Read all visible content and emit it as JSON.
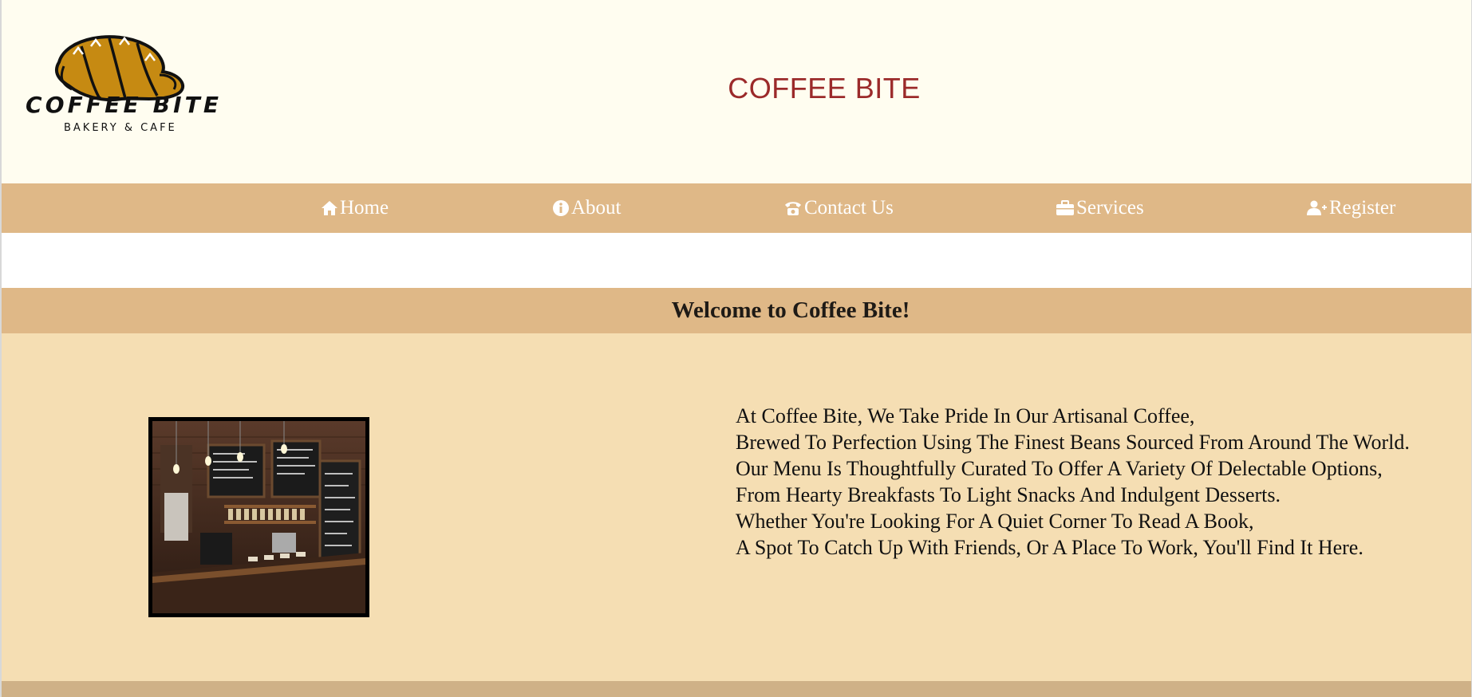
{
  "header": {
    "logo": {
      "title": "COFFEE BITE",
      "subtitle": "BAKERY & CAFE",
      "icon": "croissant-icon"
    },
    "site_title": "COFFEE BITE"
  },
  "nav": {
    "items": [
      {
        "label": "Home",
        "icon": "home-icon"
      },
      {
        "label": "About",
        "icon": "info-icon"
      },
      {
        "label": "Contact Us",
        "icon": "phone-icon"
      },
      {
        "label": "Services",
        "icon": "briefcase-icon"
      },
      {
        "label": "Register",
        "icon": "user-plus-icon"
      }
    ]
  },
  "welcome": {
    "heading": "Welcome to Coffee Bite!"
  },
  "main": {
    "image": {
      "name": "cafe-interior-photo"
    },
    "paragraph": [
      "At Coffee Bite, We Take Pride In Our Artisanal Coffee,",
      "Brewed To Perfection Using The Finest Beans Sourced From Around The World.",
      "Our Menu Is Thoughtfully Curated To Offer A Variety Of Delectable Options,",
      "From Hearty Breakfasts To Light Snacks And Indulgent Desserts.",
      "Whether You're Looking For A Quiet Corner To Read A Book,",
      "A Spot To Catch Up With Friends, Or A Place To Work, You'll Find It Here."
    ]
  },
  "colors": {
    "header_bg": "#fffdf0",
    "nav_bg": "#dfb887",
    "title_red": "#9b2a2a",
    "main_bg": "#f5deb3",
    "footer_bg": "#cfb187"
  }
}
